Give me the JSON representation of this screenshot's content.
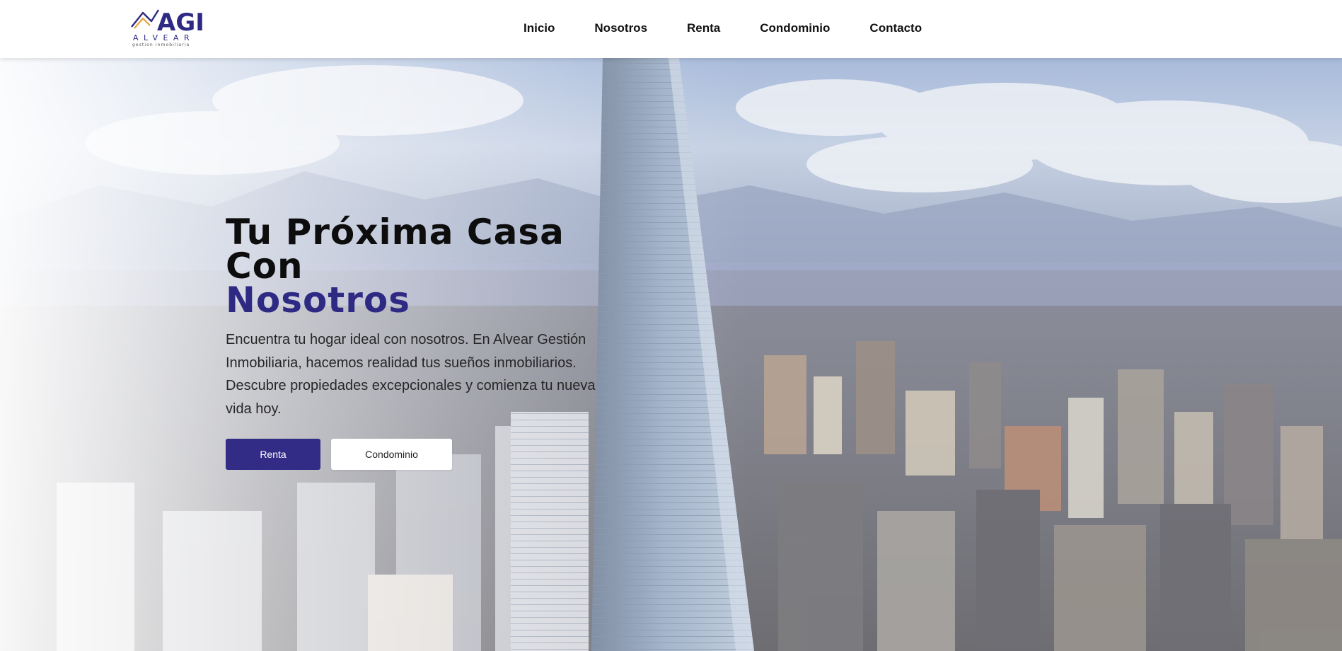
{
  "brand": {
    "logo_text": "AGI",
    "logo_sub": "ALVEAR",
    "logo_tagline": "gestion inmobiliaria",
    "logo_colors": {
      "primary": "#2e2a84",
      "accent": "#e8a33a"
    }
  },
  "nav": {
    "items": [
      {
        "label": "Inicio"
      },
      {
        "label": "Nosotros"
      },
      {
        "label": "Renta"
      },
      {
        "label": "Condominio"
      },
      {
        "label": "Contacto"
      }
    ]
  },
  "hero": {
    "title_line1": "Tu Próxima Casa Con",
    "title_line2": "Nosotros",
    "description": "Encuentra tu hogar ideal con nosotros. En Alvear Gestión Inmobiliaria, hacemos realidad tus sueños inmobiliarios. Descubre propiedades excepcionales y comienza tu nueva vida hoy.",
    "primary_button": "Renta",
    "secondary_button": "Condominio"
  },
  "colors": {
    "accent": "#2e2a84",
    "button_primary_bg": "#332c87",
    "text_dark": "#0d0d0d"
  }
}
